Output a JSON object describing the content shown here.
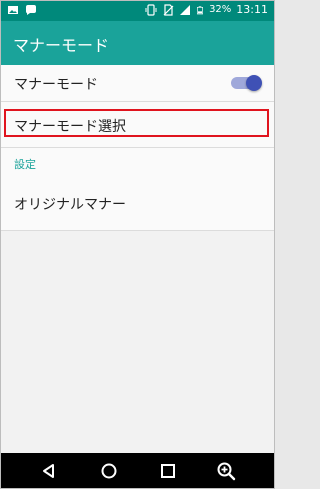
{
  "statusbar": {
    "battery": "32%",
    "time": "13:11"
  },
  "appbar": {
    "title": "マナーモード"
  },
  "settings": {
    "manner_mode": {
      "label": "マナーモード",
      "enabled": true
    },
    "manner_mode_select": {
      "label": "マナーモード選択"
    },
    "section_header": "設定",
    "original_manner": {
      "label": "オリジナルマナー"
    }
  },
  "colors": {
    "accent": "#1aa39a",
    "highlight": "#e0141e",
    "toggle": "#3f51b5"
  }
}
